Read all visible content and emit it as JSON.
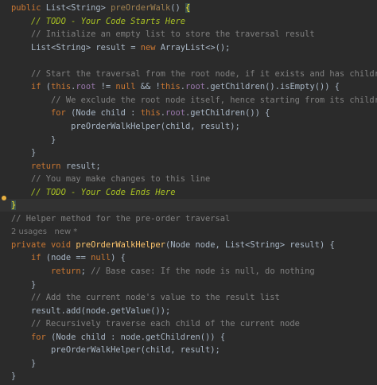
{
  "code": {
    "lines": [
      {
        "indent": "",
        "tokens": [
          [
            "kw",
            "public"
          ],
          [
            "id",
            " List"
          ],
          [
            "op",
            "<"
          ],
          [
            "id",
            "String"
          ],
          [
            "op",
            "> "
          ],
          [
            "fnu",
            "preOrderWalk"
          ],
          [
            "op",
            "() "
          ],
          [
            "brace",
            "{"
          ]
        ]
      },
      {
        "indent": "    ",
        "tokens": [
          [
            "todo",
            "// TODO - Your Code Starts Here"
          ]
        ]
      },
      {
        "indent": "    ",
        "tokens": [
          [
            "cm",
            "// Initialize an empty list to store the traversal result"
          ]
        ]
      },
      {
        "indent": "    ",
        "tokens": [
          [
            "id",
            "List"
          ],
          [
            "op",
            "<"
          ],
          [
            "id",
            "String"
          ],
          [
            "op",
            "> "
          ],
          [
            "id",
            "result"
          ],
          [
            "op",
            " = "
          ],
          [
            "kw",
            "new"
          ],
          [
            "id",
            " ArrayList"
          ],
          [
            "op",
            "<>();"
          ]
        ]
      },
      {
        "indent": "",
        "tokens": []
      },
      {
        "indent": "    ",
        "tokens": [
          [
            "cm",
            "// Start the traversal from the root node, if it exists and has children"
          ]
        ]
      },
      {
        "indent": "    ",
        "tokens": [
          [
            "kw",
            "if"
          ],
          [
            "op",
            " ("
          ],
          [
            "kw",
            "this"
          ],
          [
            "op",
            "."
          ],
          [
            "field",
            "root"
          ],
          [
            "op",
            " != "
          ],
          [
            "kw",
            "null"
          ],
          [
            "op",
            " && !"
          ],
          [
            "kw",
            "this"
          ],
          [
            "op",
            "."
          ],
          [
            "field",
            "root"
          ],
          [
            "op",
            "."
          ],
          [
            "id",
            "getChildren"
          ],
          [
            "op",
            "()."
          ],
          [
            "id",
            "isEmpty"
          ],
          [
            "op",
            "()) {"
          ]
        ]
      },
      {
        "indent": "        ",
        "tokens": [
          [
            "cm",
            "// We exclude the root node itself, hence starting from its children"
          ]
        ]
      },
      {
        "indent": "        ",
        "tokens": [
          [
            "kw",
            "for"
          ],
          [
            "op",
            " ("
          ],
          [
            "id",
            "Node child"
          ],
          [
            "op",
            " : "
          ],
          [
            "kw",
            "this"
          ],
          [
            "op",
            "."
          ],
          [
            "field",
            "root"
          ],
          [
            "op",
            "."
          ],
          [
            "id",
            "getChildren"
          ],
          [
            "op",
            "()) {"
          ]
        ]
      },
      {
        "indent": "            ",
        "tokens": [
          [
            "id",
            "preOrderWalkHelper"
          ],
          [
            "op",
            "("
          ],
          [
            "id",
            "child"
          ],
          [
            "op",
            ", "
          ],
          [
            "id",
            "result"
          ],
          [
            "op",
            ");"
          ]
        ]
      },
      {
        "indent": "        ",
        "tokens": [
          [
            "op",
            "}"
          ]
        ]
      },
      {
        "indent": "    ",
        "tokens": [
          [
            "op",
            "}"
          ]
        ]
      },
      {
        "indent": "    ",
        "tokens": [
          [
            "kw",
            "return"
          ],
          [
            "id",
            " result"
          ],
          [
            "op",
            ";"
          ]
        ]
      },
      {
        "indent": "    ",
        "tokens": [
          [
            "cm",
            "// You may make changes to this line"
          ]
        ]
      },
      {
        "indent": "    ",
        "tokens": [
          [
            "todo",
            "// TODO - Your Code Ends Here"
          ]
        ]
      },
      {
        "indent": "",
        "tokens": [
          [
            "brace",
            "}"
          ]
        ]
      },
      {
        "indent": "",
        "tokens": [
          [
            "cm",
            "// Helper method for the pre-order traversal"
          ]
        ]
      },
      {
        "indent": "",
        "tokens": [
          [
            "usage",
            "2 usages   new *"
          ]
        ]
      },
      {
        "indent": "",
        "tokens": [
          [
            "kw",
            "private void "
          ],
          [
            "fn",
            "preOrderWalkHelper"
          ],
          [
            "op",
            "("
          ],
          [
            "id",
            "Node node"
          ],
          [
            "op",
            ", "
          ],
          [
            "id",
            "List"
          ],
          [
            "op",
            "<"
          ],
          [
            "id",
            "String"
          ],
          [
            "op",
            "> "
          ],
          [
            "id",
            "result"
          ],
          [
            "op",
            ") {"
          ]
        ]
      },
      {
        "indent": "    ",
        "tokens": [
          [
            "kw",
            "if"
          ],
          [
            "op",
            " ("
          ],
          [
            "id",
            "node"
          ],
          [
            "op",
            " == "
          ],
          [
            "kw",
            "null"
          ],
          [
            "op",
            ") {"
          ]
        ]
      },
      {
        "indent": "        ",
        "tokens": [
          [
            "kw",
            "return"
          ],
          [
            "op",
            "; "
          ],
          [
            "cm",
            "// Base case: If the node is null, do nothing"
          ]
        ]
      },
      {
        "indent": "    ",
        "tokens": [
          [
            "op",
            "}"
          ]
        ]
      },
      {
        "indent": "    ",
        "tokens": [
          [
            "cm",
            "// Add the current node's value to the result list"
          ]
        ]
      },
      {
        "indent": "    ",
        "tokens": [
          [
            "id",
            "result"
          ],
          [
            "op",
            "."
          ],
          [
            "id",
            "add"
          ],
          [
            "op",
            "("
          ],
          [
            "id",
            "node"
          ],
          [
            "op",
            "."
          ],
          [
            "id",
            "getValue"
          ],
          [
            "op",
            "());"
          ]
        ]
      },
      {
        "indent": "    ",
        "tokens": [
          [
            "cm",
            "// Recursively traverse each child of the current node"
          ]
        ]
      },
      {
        "indent": "    ",
        "tokens": [
          [
            "kw",
            "for"
          ],
          [
            "op",
            " ("
          ],
          [
            "id",
            "Node child"
          ],
          [
            "op",
            " : "
          ],
          [
            "id",
            "node"
          ],
          [
            "op",
            "."
          ],
          [
            "id",
            "getChildren"
          ],
          [
            "op",
            "()) {"
          ]
        ]
      },
      {
        "indent": "        ",
        "tokens": [
          [
            "id",
            "preOrderWalkHelper"
          ],
          [
            "op",
            "("
          ],
          [
            "id",
            "child"
          ],
          [
            "op",
            ", "
          ],
          [
            "id",
            "result"
          ],
          [
            "op",
            ");"
          ]
        ]
      },
      {
        "indent": "    ",
        "tokens": [
          [
            "op",
            "}"
          ]
        ]
      },
      {
        "indent": "",
        "tokens": [
          [
            "op",
            "}"
          ]
        ]
      }
    ]
  },
  "gutter": {
    "bulb_line": 15,
    "icon": "lightbulb-icon"
  },
  "colors": {
    "background": "#2b2b2b",
    "keyword": "#cc7832",
    "function": "#ffc66d",
    "comment": "#808080",
    "todo": "#a8c023",
    "field": "#9876aa"
  }
}
